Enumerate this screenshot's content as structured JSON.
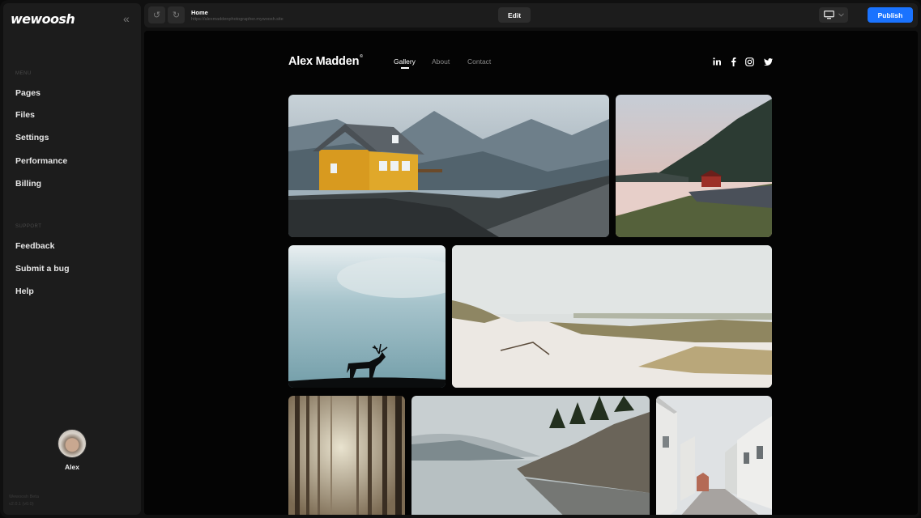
{
  "app": {
    "logo": "wewoosh",
    "collapse_icon": "«",
    "version_line1": "Wewoosh Beta",
    "version_line2": "v2.0.1 (v0.0)"
  },
  "sidebar": {
    "menu_label": "MENU",
    "menu_items": [
      {
        "label": "Pages"
      },
      {
        "label": "Files"
      },
      {
        "label": "Settings"
      },
      {
        "label": "Performance"
      },
      {
        "label": "Billing"
      }
    ],
    "support_label": "SUPPORT",
    "support_items": [
      {
        "label": "Feedback"
      },
      {
        "label": "Submit a bug"
      },
      {
        "label": "Help"
      }
    ],
    "user": {
      "name": "Alex"
    }
  },
  "topbar": {
    "undo_icon": "↺",
    "redo_icon": "↻",
    "page_name": "Home",
    "page_url": "https://alexmaddenphotographer.mywoosh.site",
    "edit_label": "Edit",
    "device_icon": "desktop-icon",
    "publish_label": "Publish"
  },
  "site": {
    "title": "Alex Madden",
    "title_mark": "©",
    "nav": [
      {
        "label": "Gallery",
        "active": true
      },
      {
        "label": "About",
        "active": false
      },
      {
        "label": "Contact",
        "active": false
      }
    ],
    "social": [
      "linkedin-icon",
      "facebook-icon",
      "instagram-icon",
      "twitter-icon"
    ]
  },
  "colors": {
    "accent": "#1a73ff",
    "sidebar_bg": "#1c1c1c",
    "canvas_bg": "#040404"
  }
}
